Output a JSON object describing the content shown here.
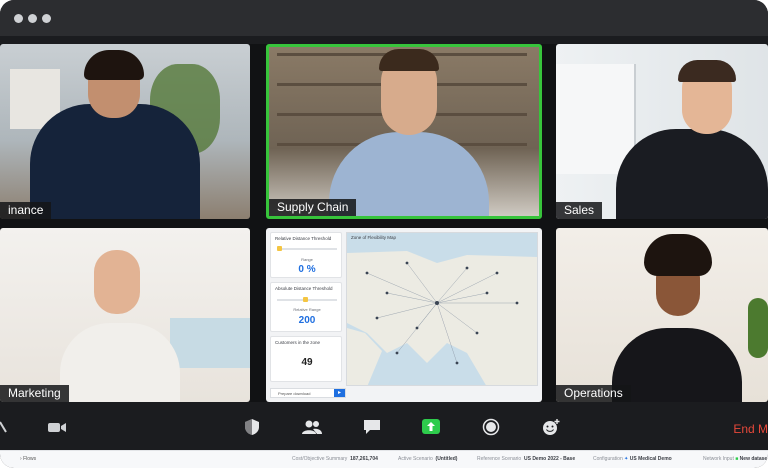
{
  "participants": [
    {
      "name": "inance"
    },
    {
      "name": "Supply Chain",
      "active_speaker": true
    },
    {
      "name": "Sales"
    },
    {
      "name": "Marketing"
    },
    {
      "name": "Operations"
    }
  ],
  "dashboard": {
    "cards": [
      {
        "title": "Relative Distance Threshold",
        "sub": "Range",
        "value": "0 %"
      },
      {
        "title": "Absolute Distance Threshold",
        "sub": "Relative Range",
        "value": "200"
      },
      {
        "title": "Customers in the zone",
        "sub": "",
        "value": "49"
      }
    ],
    "map_title": "Zone of Flexibility Map",
    "download_label": "Prepare download"
  },
  "toolbar": {
    "icons": [
      "mute-icon",
      "video-icon",
      "security-shield-icon",
      "participants-icon",
      "chat-icon",
      "share-screen-icon",
      "record-icon",
      "reactions-icon"
    ],
    "end_label": "End M"
  },
  "statusbar": {
    "flows": "Flows",
    "cost_label": "Cost/Objective Summary",
    "cost_value": "187,261,704",
    "active_label": "Active Scenario",
    "active_value": "(Untitled)",
    "reference_label": "Reference Scenario",
    "reference_value": "US Demo 2022 - Base",
    "config_label": "Configuration",
    "config_value": "US Medical Demo",
    "network_label": "Network Input",
    "network_value": "New datase"
  },
  "colors": {
    "active_border": "#37c43b",
    "end_button": "#e5483a",
    "accent": "#1f6fe0"
  }
}
